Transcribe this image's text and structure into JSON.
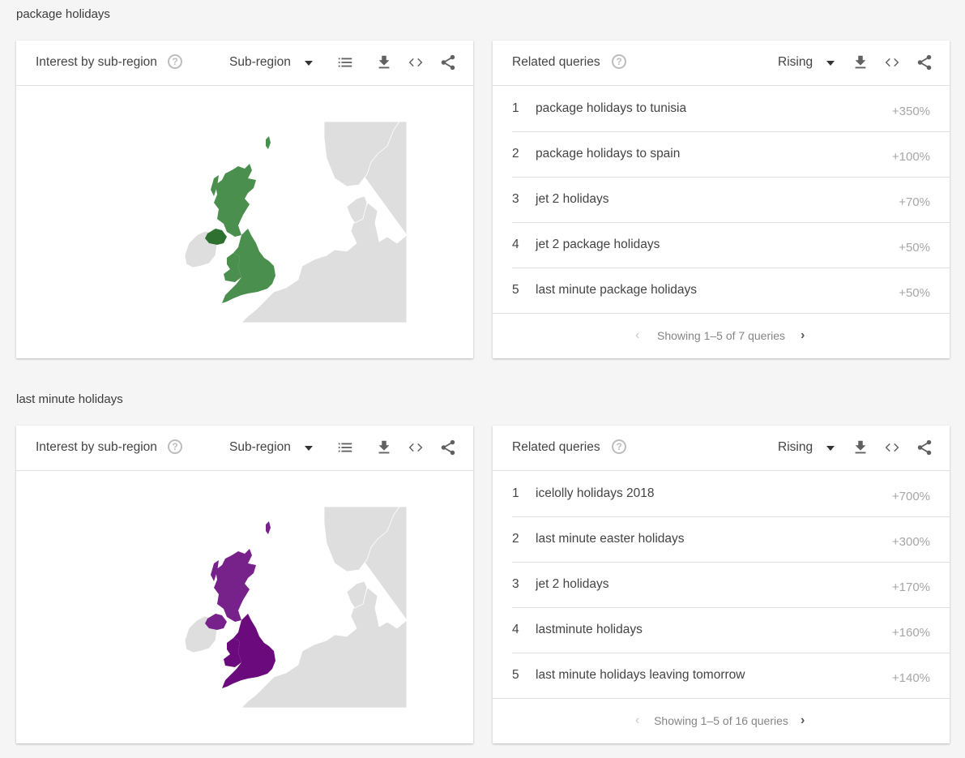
{
  "sections": [
    {
      "title": "package holidays",
      "region_card": {
        "title": "Interest by sub-region",
        "help": "?",
        "resolution_select": "Sub-region",
        "map_colors": {
          "england": "#4a8f4e",
          "scotland": "#4a8f4e",
          "wales": "#4a8f4e",
          "northern_ireland": "#2e7030",
          "other_land": "#dedede"
        }
      },
      "queries_card": {
        "title": "Related queries",
        "help": "?",
        "filter_select": "Rising",
        "rows": [
          {
            "rank": "1",
            "query": "package holidays to tunisia",
            "value": "+350%"
          },
          {
            "rank": "2",
            "query": "package holidays to spain",
            "value": "+100%"
          },
          {
            "rank": "3",
            "query": "jet 2 holidays",
            "value": "+70%"
          },
          {
            "rank": "4",
            "query": "jet 2 package holidays",
            "value": "+50%"
          },
          {
            "rank": "5",
            "query": "last minute package holidays",
            "value": "+50%"
          }
        ],
        "pagination": "Showing 1–5 of 7 queries"
      }
    },
    {
      "title": "last minute holidays",
      "region_card": {
        "title": "Interest by sub-region",
        "help": "?",
        "resolution_select": "Sub-region",
        "map_colors": {
          "england": "#6b0a7d",
          "scotland": "#77228a",
          "wales": "#6b0a7d",
          "northern_ireland": "#77228a",
          "other_land": "#dedede"
        }
      },
      "queries_card": {
        "title": "Related queries",
        "help": "?",
        "filter_select": "Rising",
        "rows": [
          {
            "rank": "1",
            "query": "icelolly holidays 2018",
            "value": "+700%"
          },
          {
            "rank": "2",
            "query": "last minute easter holidays",
            "value": "+300%"
          },
          {
            "rank": "3",
            "query": "jet 2 holidays",
            "value": "+170%"
          },
          {
            "rank": "4",
            "query": "lastminute holidays",
            "value": "+160%"
          },
          {
            "rank": "5",
            "query": "last minute holidays leaving tomorrow",
            "value": "+140%"
          }
        ],
        "pagination": "Showing 1–5 of 16 queries"
      }
    }
  ],
  "icons": {
    "list": "list-icon",
    "download": "download-icon",
    "embed": "embed-code-icon",
    "share": "share-icon",
    "prev": "‹",
    "next": "›"
  }
}
